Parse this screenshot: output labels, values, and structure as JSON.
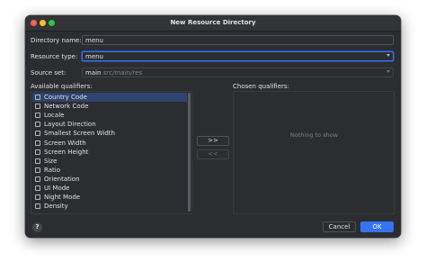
{
  "window": {
    "title": "New Resource Directory"
  },
  "form": {
    "directory_name_label": "Directory name:",
    "directory_name_value": "menu",
    "resource_type_label": "Resource type:",
    "resource_type_value": "menu",
    "source_set_label": "Source set:",
    "source_set_value": "main",
    "source_set_hint": "src/main/res"
  },
  "qualifiers": {
    "available_label": "Available qualifiers:",
    "chosen_label": "Chosen qualifiers:",
    "items": [
      {
        "label": "Country Code",
        "icon": "globe-icon"
      },
      {
        "label": "Network Code",
        "icon": "network-icon"
      },
      {
        "label": "Locale",
        "icon": "locale-icon"
      },
      {
        "label": "Layout Direction",
        "icon": "layout-direction-icon"
      },
      {
        "label": "Smallest Screen Width",
        "icon": "screen-width-icon"
      },
      {
        "label": "Screen Width",
        "icon": "screen-width-icon"
      },
      {
        "label": "Screen Height",
        "icon": "screen-height-icon"
      },
      {
        "label": "Size",
        "icon": "size-icon"
      },
      {
        "label": "Ratio",
        "icon": "ratio-icon"
      },
      {
        "label": "Orientation",
        "icon": "orientation-icon"
      },
      {
        "label": "UI Mode",
        "icon": "ui-mode-icon"
      },
      {
        "label": "Night Mode",
        "icon": "night-mode-icon"
      },
      {
        "label": "Density",
        "icon": "density-icon"
      }
    ],
    "selected_index": 0,
    "add_button": ">>",
    "remove_button": "<<",
    "chosen_empty": "Nothing to show"
  },
  "footer": {
    "help": "?",
    "cancel": "Cancel",
    "ok": "OK"
  },
  "colors": {
    "accent": "#3574f0",
    "selection": "#2e436e",
    "background": "#2b2d30"
  }
}
